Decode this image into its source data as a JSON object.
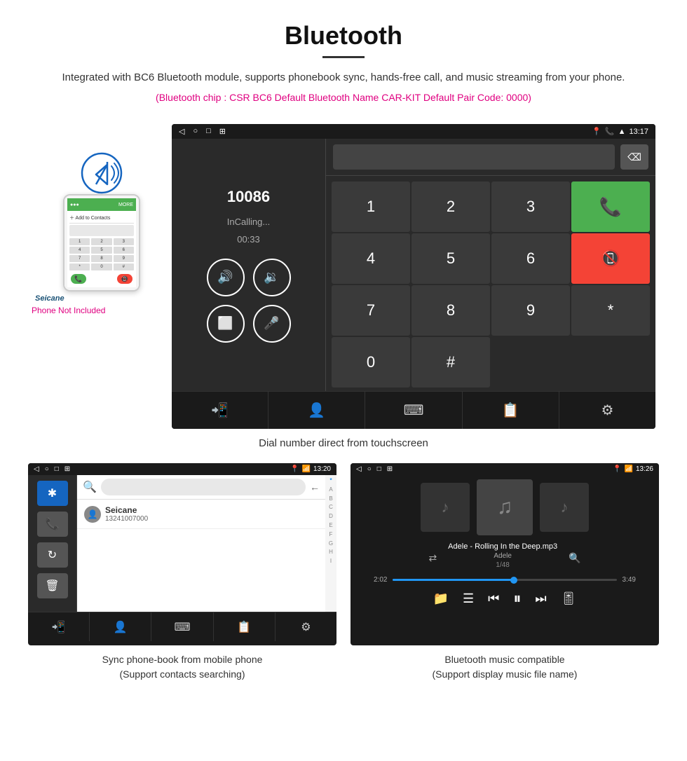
{
  "header": {
    "title": "Bluetooth",
    "description": "Integrated with BC6 Bluetooth module, supports phonebook sync, hands-free call, and music streaming from your phone.",
    "specs": "(Bluetooth chip : CSR BC6    Default Bluetooth Name CAR-KIT    Default Pair Code: 0000)"
  },
  "main_demo": {
    "call_number": "10086",
    "call_status": "InCalling...",
    "call_timer": "00:33",
    "status_bar_time": "13:17",
    "caption": "Dial number direct from touchscreen",
    "dialpad": {
      "keys": [
        "1",
        "2",
        "3",
        "*",
        "4",
        "5",
        "6",
        "0",
        "7",
        "8",
        "9",
        "#"
      ]
    }
  },
  "phone": {
    "not_included": "Phone Not Included",
    "brand": "Seicane",
    "keypad": [
      "1",
      "2",
      "3",
      "4",
      "5",
      "6",
      "7",
      "8",
      "9",
      "*",
      "0",
      "#"
    ]
  },
  "phonebook_screen": {
    "status_time": "13:20",
    "contact_name": "Seicane",
    "contact_number": "13241007000",
    "caption_line1": "Sync phone-book from mobile phone",
    "caption_line2": "(Support contacts searching)",
    "alphabet": [
      "*",
      "A",
      "B",
      "C",
      "D",
      "E",
      "F",
      "G",
      "H",
      "I"
    ]
  },
  "music_screen": {
    "status_time": "13:26",
    "track_name": "Adele - Rolling In the Deep.mp3",
    "artist": "Adele",
    "track_position": "1/48",
    "time_elapsed": "2:02",
    "time_total": "3:49",
    "caption_line1": "Bluetooth music compatible",
    "caption_line2": "(Support display music file name)"
  }
}
